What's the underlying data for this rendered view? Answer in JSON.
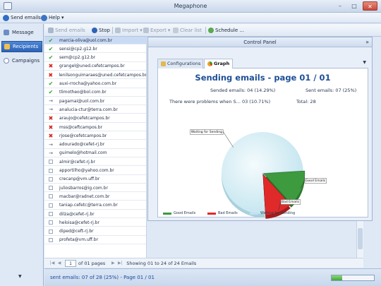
{
  "window": {
    "title": "Megaphone",
    "minimize": "–",
    "maximize": "□",
    "close": "✕"
  },
  "menu": {
    "send_emails": "Send emails",
    "help": "Help",
    "dropdown_glyph": "▾"
  },
  "nav": {
    "items": [
      {
        "label": "Message"
      },
      {
        "label": "Recipients"
      },
      {
        "label": "Campaigns"
      }
    ],
    "scroll_glyph": "▼"
  },
  "toolbar": {
    "send_emails": "Send emails",
    "stop": "Stop",
    "import": "Import",
    "export": "Export",
    "clear_list": "Clear list",
    "schedule": "Schedule ..."
  },
  "emails": [
    {
      "address": "marcia-oliva@uol.com.br",
      "status": "ok"
    },
    {
      "address": "sensi@cp2.g12.br",
      "status": "ok"
    },
    {
      "address": "sem@cp2.g12.br",
      "status": "ok"
    },
    {
      "address": "grangel@uned.cefetcampos.br",
      "status": "err"
    },
    {
      "address": "lenilsonguimaraes@uned.cefetcampos.br",
      "status": "err"
    },
    {
      "address": "auxi-rrocha@yahoo.com.br",
      "status": "ok"
    },
    {
      "address": "tlimotheo@bol.com.br",
      "status": "ok"
    },
    {
      "address": "pagamai@uol.com.br",
      "status": "wait"
    },
    {
      "address": "analucia-ctur@terra.com.br",
      "status": "wait"
    },
    {
      "address": "araujo@cefetcampos.br",
      "status": "err"
    },
    {
      "address": "mss@ceftcampos.br",
      "status": "err"
    },
    {
      "address": "rjose@cefetcampos.br",
      "status": "err"
    },
    {
      "address": "adourado@cefet-rj.br",
      "status": "wait"
    },
    {
      "address": "guimelo@hotmail.com",
      "status": "wait"
    },
    {
      "address": "almir@cefet-rj.br",
      "status": "none"
    },
    {
      "address": "apportilho@yahoo.com.br",
      "status": "none"
    },
    {
      "address": "crecanp@vm.uff.br",
      "status": "none"
    },
    {
      "address": "juliosbarros@ig.com.br",
      "status": "none"
    },
    {
      "address": "macbar@radnet.com.br",
      "status": "none"
    },
    {
      "address": "taniap.cefetc@terra.com.br",
      "status": "none"
    },
    {
      "address": "dilza@cefet-rj.br",
      "status": "none"
    },
    {
      "address": "heloisa@cefet-rj.br",
      "status": "none"
    },
    {
      "address": "diped@ceft-rj.br",
      "status": "none"
    },
    {
      "address": "profeta@vm.uff.br",
      "status": "none"
    }
  ],
  "pager": {
    "page_value": "1",
    "of_pages": "of 01 pages",
    "showing": "Showing 01 to 24 of 24 Emails"
  },
  "status": {
    "text": "sent emails: 07 of 28 (25%) - Page 01 / 01",
    "progress_fraction": 0.25
  },
  "control_panel": {
    "header": "Control Panel",
    "collapse_glyph": "»",
    "tabs": [
      {
        "label": "Configurations"
      },
      {
        "label": "Graph"
      }
    ],
    "tab_menu_glyph": "▼",
    "graph": {
      "title": "Sending emails - page 01 / 01",
      "sended": "Sended emails:  04 (14.29%)",
      "sent": "Sent emails:  07 (25%)",
      "problems": "There were problems when S...  03 (10.71%)",
      "total": "Total:  28",
      "callout_waiting": "Waiting for Sending",
      "callout_good": "Good Emails",
      "callout_bad": "Bad Emails"
    },
    "legend": [
      {
        "label": "Good Emails",
        "color": "#3e9a3e"
      },
      {
        "label": "Bad Emails",
        "color": "#e02a2a"
      },
      {
        "label": "Waiting for Sending",
        "color": "#bfe3ee"
      }
    ]
  },
  "chart_data": {
    "type": "pie",
    "title": "",
    "slices": [
      {
        "name": "Good Emails",
        "value": 4,
        "color": "#3e9a3e"
      },
      {
        "name": "Bad Emails",
        "value": 3,
        "color": "#e02a2a"
      },
      {
        "name": "Waiting for Sending",
        "value": 21,
        "color": "#cfeaf2"
      }
    ],
    "legend": "bottom"
  }
}
